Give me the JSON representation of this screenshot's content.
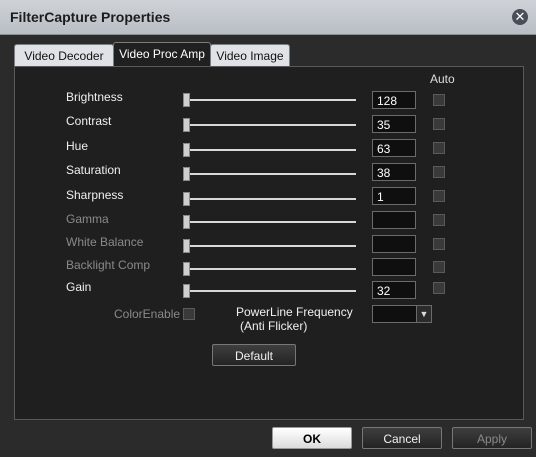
{
  "window": {
    "title": "FilterCapture Properties"
  },
  "tabs": [
    "Video Decoder",
    "Video Proc Amp",
    "Video Image"
  ],
  "columns": {
    "auto": "Auto"
  },
  "controls": [
    {
      "label": "Brightness",
      "value": "128",
      "enabled": true
    },
    {
      "label": "Contrast",
      "value": "35",
      "enabled": true
    },
    {
      "label": "Hue",
      "value": "63",
      "enabled": true
    },
    {
      "label": "Saturation",
      "value": "38",
      "enabled": true
    },
    {
      "label": "Sharpness",
      "value": "1",
      "enabled": true
    },
    {
      "label": "Gamma",
      "value": "",
      "enabled": false
    },
    {
      "label": "White Balance",
      "value": "",
      "enabled": false
    },
    {
      "label": "Backlight Comp",
      "value": "",
      "enabled": false
    },
    {
      "label": "Gain",
      "value": "32",
      "enabled": true
    }
  ],
  "color_enable": "ColorEnable",
  "powerline": {
    "line1": "PowerLine Frequency",
    "line2": "(Anti Flicker)",
    "value": ""
  },
  "buttons": {
    "default": "Default",
    "ok": "OK",
    "cancel": "Cancel",
    "apply": "Apply"
  }
}
